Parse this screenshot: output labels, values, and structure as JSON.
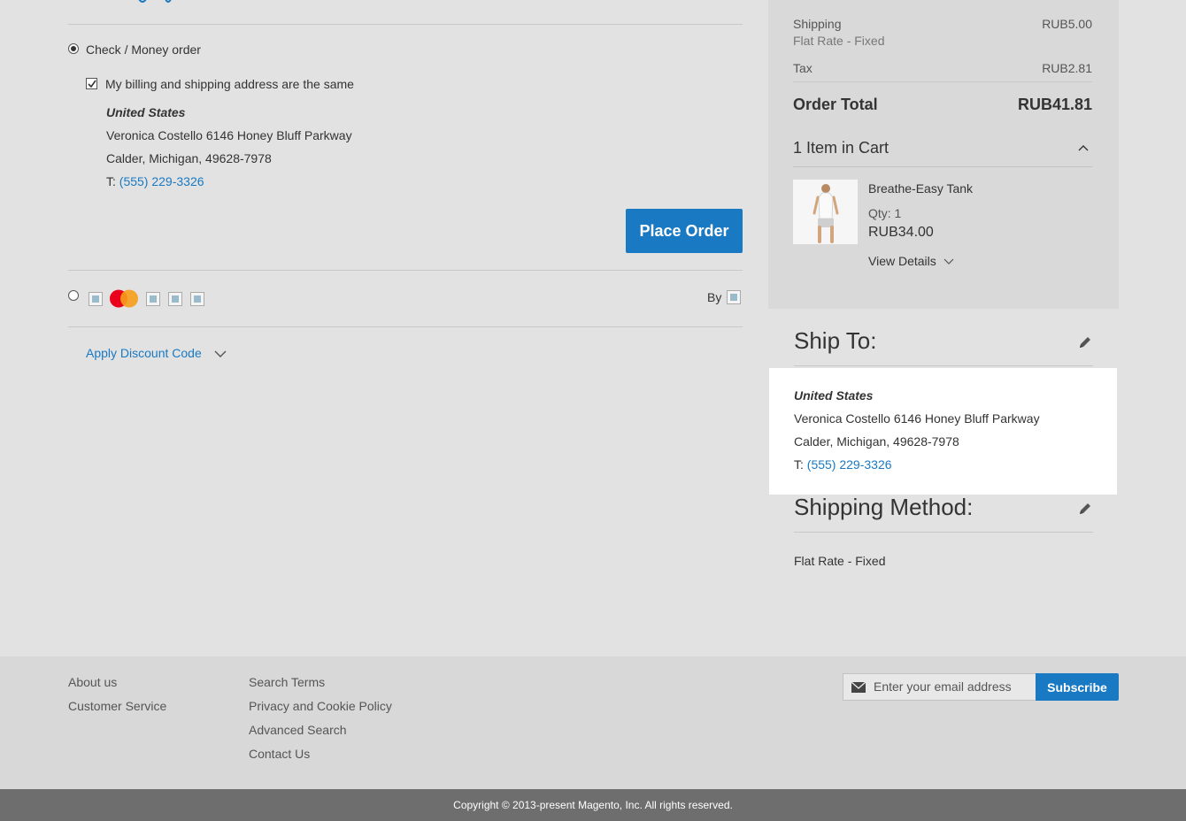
{
  "payment": {
    "check_money_label": "Check / Money order",
    "same_address_label": "My billing and shipping address are the same",
    "billing": {
      "country": "United States",
      "line1": "Veronica Costello 6146 Honey Bluff Parkway",
      "line2": "Calder, Michigan, 49628-7978",
      "phone_prefix": "T: ",
      "phone": "(555) 229-3326"
    },
    "place_order_label": "Place Order",
    "by_label": "By",
    "discount_label": "Apply Discount Code"
  },
  "summary": {
    "shipping_label": "Shipping",
    "shipping_method": "Flat Rate - Fixed",
    "shipping_value": "RUB5.00",
    "tax_label": "Tax",
    "tax_value": "RUB2.81",
    "order_total_label": "Order Total",
    "order_total_value": "RUB41.81",
    "items_in_cart": "1 Item in Cart",
    "item": {
      "name": "Breathe-Easy Tank",
      "qty": "Qty: 1",
      "price": "RUB34.00",
      "view_details": "View Details"
    }
  },
  "ship_to": {
    "title": "Ship To:",
    "country": "United States",
    "line1": "Veronica Costello 6146 Honey Bluff Parkway",
    "line2": "Calder, Michigan, 49628-7978",
    "phone_prefix": "T: ",
    "phone": "(555) 229-3326"
  },
  "shipping_method": {
    "title": "Shipping Method:",
    "value": "Flat Rate - Fixed"
  },
  "footer": {
    "links_col1": [
      "About us",
      "Customer Service"
    ],
    "links_col2": [
      "Search Terms",
      "Privacy and Cookie Policy",
      "Advanced Search",
      "Contact Us"
    ],
    "email_placeholder": "Enter your email address",
    "subscribe_label": "Subscribe",
    "copyright": "Copyright © 2013-present Magento, Inc. All rights reserved."
  },
  "colors": {
    "primary": "#1979c3",
    "background": "#e2e2e2",
    "summary_bg": "#d9d9d9",
    "footer_bg": "#d8d8d8",
    "copyright_bg": "#6e6e6e"
  }
}
